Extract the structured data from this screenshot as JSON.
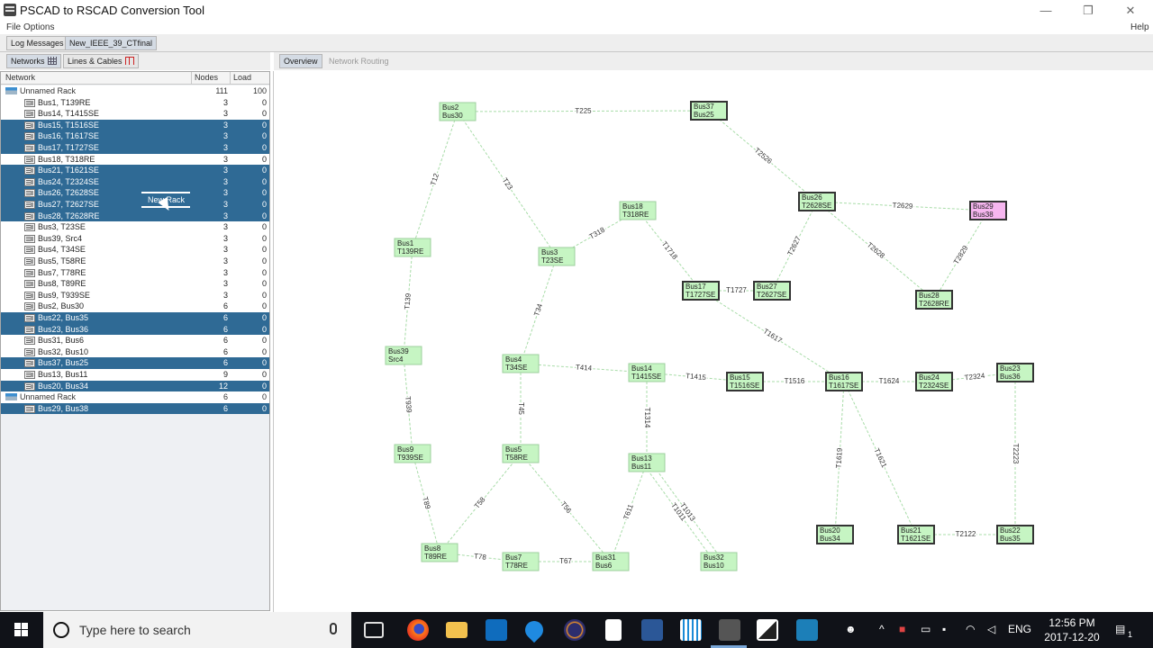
{
  "window": {
    "title": "PSCAD to RSCAD Conversion Tool",
    "controls": {
      "minimize": "—",
      "restore": "❐",
      "close": "✕"
    }
  },
  "menu": {
    "file": "File",
    "options": "Options",
    "help": "Help"
  },
  "doc_tabs": [
    "Log Messages",
    "New_IEEE_39_CTfinal"
  ],
  "left_tabs": [
    "Networks",
    "Lines & Cables"
  ],
  "right_tabs": [
    "Overview",
    "Network Routing"
  ],
  "tree": {
    "headers": {
      "network": "Network",
      "nodes": "Nodes",
      "load": "Load"
    },
    "rows": [
      {
        "name": "Unnamed Rack",
        "nodes": "111",
        "load": "100",
        "rack": true,
        "sel": false
      },
      {
        "name": "Bus1, T139RE",
        "nodes": "3",
        "load": "0",
        "rack": false,
        "sel": false
      },
      {
        "name": "Bus14, T1415SE",
        "nodes": "3",
        "load": "0",
        "rack": false,
        "sel": false
      },
      {
        "name": "Bus15, T1516SE",
        "nodes": "3",
        "load": "0",
        "rack": false,
        "sel": true
      },
      {
        "name": "Bus16, T1617SE",
        "nodes": "3",
        "load": "0",
        "rack": false,
        "sel": true
      },
      {
        "name": "Bus17, T1727SE",
        "nodes": "3",
        "load": "0",
        "rack": false,
        "sel": true
      },
      {
        "name": "Bus18, T318RE",
        "nodes": "3",
        "load": "0",
        "rack": false,
        "sel": false
      },
      {
        "name": "Bus21, T1621SE",
        "nodes": "3",
        "load": "0",
        "rack": false,
        "sel": true
      },
      {
        "name": "Bus24, T2324SE",
        "nodes": "3",
        "load": "0",
        "rack": false,
        "sel": true
      },
      {
        "name": "Bus26, T2628SE",
        "nodes": "3",
        "load": "0",
        "rack": false,
        "sel": true
      },
      {
        "name": "Bus27, T2627SE",
        "nodes": "3",
        "load": "0",
        "rack": false,
        "sel": true
      },
      {
        "name": "Bus28, T2628RE",
        "nodes": "3",
        "load": "0",
        "rack": false,
        "sel": true
      },
      {
        "name": "Bus3, T23SE",
        "nodes": "3",
        "load": "0",
        "rack": false,
        "sel": false
      },
      {
        "name": "Bus39, Src4",
        "nodes": "3",
        "load": "0",
        "rack": false,
        "sel": false
      },
      {
        "name": "Bus4, T34SE",
        "nodes": "3",
        "load": "0",
        "rack": false,
        "sel": false
      },
      {
        "name": "Bus5, T58RE",
        "nodes": "3",
        "load": "0",
        "rack": false,
        "sel": false
      },
      {
        "name": "Bus7, T78RE",
        "nodes": "3",
        "load": "0",
        "rack": false,
        "sel": false
      },
      {
        "name": "Bus8, T89RE",
        "nodes": "3",
        "load": "0",
        "rack": false,
        "sel": false
      },
      {
        "name": "Bus9, T939SE",
        "nodes": "3",
        "load": "0",
        "rack": false,
        "sel": false
      },
      {
        "name": "Bus2, Bus30",
        "nodes": "6",
        "load": "0",
        "rack": false,
        "sel": false
      },
      {
        "name": "Bus22, Bus35",
        "nodes": "6",
        "load": "0",
        "rack": false,
        "sel": true
      },
      {
        "name": "Bus23, Bus36",
        "nodes": "6",
        "load": "0",
        "rack": false,
        "sel": true
      },
      {
        "name": "Bus31, Bus6",
        "nodes": "6",
        "load": "0",
        "rack": false,
        "sel": false
      },
      {
        "name": "Bus32, Bus10",
        "nodes": "6",
        "load": "0",
        "rack": false,
        "sel": false
      },
      {
        "name": "Bus37, Bus25",
        "nodes": "6",
        "load": "0",
        "rack": false,
        "sel": true
      },
      {
        "name": "Bus13, Bus11",
        "nodes": "9",
        "load": "0",
        "rack": false,
        "sel": false
      },
      {
        "name": "Bus20, Bus34",
        "nodes": "12",
        "load": "0",
        "rack": false,
        "sel": true
      },
      {
        "name": "Unnamed Rack",
        "nodes": "6",
        "load": "0",
        "rack": true,
        "sel": false
      },
      {
        "name": "Bus29, Bus38",
        "nodes": "6",
        "load": "0",
        "rack": false,
        "sel": true
      }
    ],
    "drag_label": "New Rack"
  },
  "network": {
    "colors": {
      "node_fill": "#c6f5c3",
      "node_pink": "#f6b6ef",
      "edge": "#a8dca8",
      "selected_border": "#333333"
    },
    "nodes": [
      {
        "id": "Bus2",
        "l1": "Bus2",
        "l2": "Bus30",
        "sel": false,
        "pink": false
      },
      {
        "id": "Bus37",
        "l1": "Bus37",
        "l2": "Bus25",
        "sel": true,
        "pink": false
      },
      {
        "id": "Bus26",
        "l1": "Bus26",
        "l2": "T2628SE",
        "sel": true,
        "pink": false
      },
      {
        "id": "Bus29",
        "l1": "Bus29",
        "l2": "Bus38",
        "sel": true,
        "pink": true
      },
      {
        "id": "Bus18",
        "l1": "Bus18",
        "l2": "T318RE",
        "sel": false,
        "pink": false
      },
      {
        "id": "Bus1",
        "l1": "Bus1",
        "l2": "T139RE",
        "sel": false,
        "pink": false
      },
      {
        "id": "Bus3",
        "l1": "Bus3",
        "l2": "T23SE",
        "sel": false,
        "pink": false
      },
      {
        "id": "Bus17",
        "l1": "Bus17",
        "l2": "T1727SE",
        "sel": true,
        "pink": false
      },
      {
        "id": "Bus27",
        "l1": "Bus27",
        "l2": "T2627SE",
        "sel": true,
        "pink": false
      },
      {
        "id": "Bus28",
        "l1": "Bus28",
        "l2": "T2628RE",
        "sel": true,
        "pink": false
      },
      {
        "id": "Bus39",
        "l1": "Bus39",
        "l2": "Src4",
        "sel": false,
        "pink": false
      },
      {
        "id": "Bus4",
        "l1": "Bus4",
        "l2": "T34SE",
        "sel": false,
        "pink": false
      },
      {
        "id": "Bus14",
        "l1": "Bus14",
        "l2": "T1415SE",
        "sel": false,
        "pink": false
      },
      {
        "id": "Bus15",
        "l1": "Bus15",
        "l2": "T1516SE",
        "sel": true,
        "pink": false
      },
      {
        "id": "Bus16",
        "l1": "Bus16",
        "l2": "T1617SE",
        "sel": true,
        "pink": false
      },
      {
        "id": "Bus24",
        "l1": "Bus24",
        "l2": "T2324SE",
        "sel": true,
        "pink": false
      },
      {
        "id": "Bus23",
        "l1": "Bus23",
        "l2": "Bus36",
        "sel": true,
        "pink": false
      },
      {
        "id": "Bus9",
        "l1": "Bus9",
        "l2": "T939SE",
        "sel": false,
        "pink": false
      },
      {
        "id": "Bus5",
        "l1": "Bus5",
        "l2": "T58RE",
        "sel": false,
        "pink": false
      },
      {
        "id": "Bus13",
        "l1": "Bus13",
        "l2": "Bus11",
        "sel": false,
        "pink": false
      },
      {
        "id": "Bus8",
        "l1": "Bus8",
        "l2": "T89RE",
        "sel": false,
        "pink": false
      },
      {
        "id": "Bus7",
        "l1": "Bus7",
        "l2": "T78RE",
        "sel": false,
        "pink": false
      },
      {
        "id": "Bus31",
        "l1": "Bus31",
        "l2": "Bus6",
        "sel": false,
        "pink": false
      },
      {
        "id": "Bus32",
        "l1": "Bus32",
        "l2": "Bus10",
        "sel": false,
        "pink": false
      },
      {
        "id": "Bus20",
        "l1": "Bus20",
        "l2": "Bus34",
        "sel": true,
        "pink": false
      },
      {
        "id": "Bus21",
        "l1": "Bus21",
        "l2": "T1621SE",
        "sel": true,
        "pink": false
      },
      {
        "id": "Bus22",
        "l1": "Bus22",
        "l2": "Bus35",
        "sel": true,
        "pink": false
      }
    ],
    "edges": [
      {
        "a": "Bus2",
        "b": "Bus37",
        "label": "T225"
      },
      {
        "a": "Bus37",
        "b": "Bus26",
        "label": "T2526"
      },
      {
        "a": "Bus26",
        "b": "Bus29",
        "label": "T2629"
      },
      {
        "a": "Bus2",
        "b": "Bus1",
        "label": "T12"
      },
      {
        "a": "Bus2",
        "b": "Bus3",
        "label": "T23"
      },
      {
        "a": "Bus3",
        "b": "Bus18",
        "label": "T318"
      },
      {
        "a": "Bus18",
        "b": "Bus17",
        "label": "T1718"
      },
      {
        "a": "Bus26",
        "b": "Bus27",
        "label": "T2627"
      },
      {
        "a": "Bus26",
        "b": "Bus28",
        "label": "T2628"
      },
      {
        "a": "Bus29",
        "b": "Bus28",
        "label": "T2829"
      },
      {
        "a": "Bus17",
        "b": "Bus27",
        "label": "T1727"
      },
      {
        "a": "Bus17",
        "b": "Bus16",
        "label": "T1617"
      },
      {
        "a": "Bus1",
        "b": "Bus39",
        "label": "T139"
      },
      {
        "a": "Bus3",
        "b": "Bus4",
        "label": "T34"
      },
      {
        "a": "Bus4",
        "b": "Bus14",
        "label": "T414"
      },
      {
        "a": "Bus14",
        "b": "Bus15",
        "label": "T1415"
      },
      {
        "a": "Bus15",
        "b": "Bus16",
        "label": "T1516"
      },
      {
        "a": "Bus16",
        "b": "Bus24",
        "label": "T1624"
      },
      {
        "a": "Bus24",
        "b": "Bus23",
        "label": "T2324"
      },
      {
        "a": "Bus39",
        "b": "Bus9",
        "label": "T939"
      },
      {
        "a": "Bus4",
        "b": "Bus5",
        "label": "T45"
      },
      {
        "a": "Bus14",
        "b": "Bus13",
        "label": "T1314"
      },
      {
        "a": "Bus16",
        "b": "Bus20",
        "label": "T1619"
      },
      {
        "a": "Bus16",
        "b": "Bus21",
        "label": "T1621"
      },
      {
        "a": "Bus23",
        "b": "Bus22",
        "label": "T2223"
      },
      {
        "a": "Bus9",
        "b": "Bus8",
        "label": "T89"
      },
      {
        "a": "Bus5",
        "b": "Bus8",
        "label": "T58"
      },
      {
        "a": "Bus5",
        "b": "Bus31",
        "label": "T56"
      },
      {
        "a": "Bus13",
        "b": "Bus31",
        "label": "T611"
      },
      {
        "a": "Bus13",
        "b": "Bus32",
        "label": "T1013"
      },
      {
        "a": "Bus13",
        "b": "Bus32",
        "label": "T1011"
      },
      {
        "a": "Bus8",
        "b": "Bus7",
        "label": "T78"
      },
      {
        "a": "Bus7",
        "b": "Bus31",
        "label": "T67"
      },
      {
        "a": "Bus21",
        "b": "Bus22",
        "label": "T2122"
      }
    ]
  },
  "taskbar": {
    "search_placeholder": "Type here to search",
    "language": "ENG",
    "time": "12:56 PM",
    "date": "2017-12-20",
    "notification_count": "1"
  }
}
